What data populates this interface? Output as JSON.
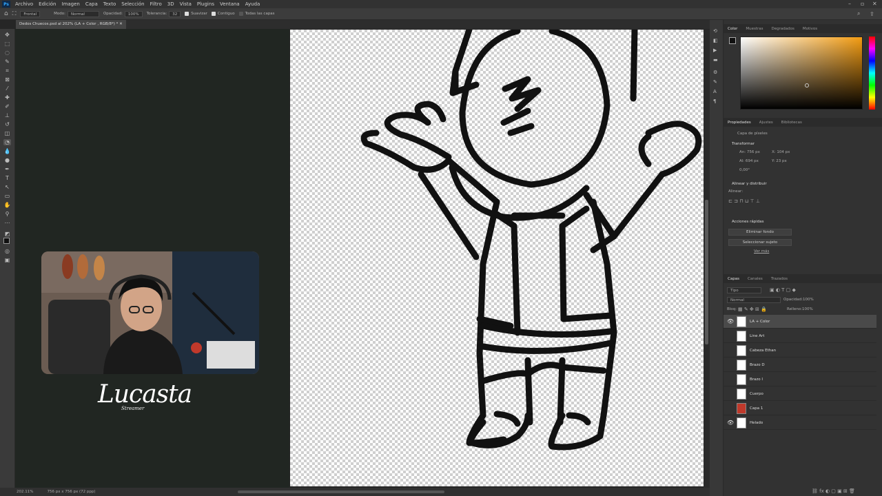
{
  "menu": [
    "Archivo",
    "Edición",
    "Imagen",
    "Capa",
    "Texto",
    "Selección",
    "Filtro",
    "3D",
    "Vista",
    "Plugins",
    "Ventana",
    "Ayuda"
  ],
  "options": {
    "view": "Frontal",
    "mode_label": "Modo:",
    "mode_value": "Normal",
    "opacity_label": "Opacidad:",
    "opacity_value": "100%",
    "tolerance_label": "Tolerancia:",
    "tolerance_value": "32",
    "smooth": "Suavizar",
    "contiguous": "Contiguo",
    "all_layers": "Todas las capas"
  },
  "document_tab": "Dedos Chuecos.psd al 202% (LA + Color , RGB/8*) *",
  "status": {
    "zoom": "202.11%",
    "size": "756 px x 756 px (72 ppp)"
  },
  "brand": {
    "name": "Lucasta",
    "sub": "Streamer"
  },
  "color_panel": {
    "tabs": [
      "Color",
      "Muestras",
      "Degradados",
      "Motivos"
    ]
  },
  "properties": {
    "tabs": [
      "Propiedades",
      "Ajustes",
      "Bibliotecas"
    ],
    "layer_type": "Capa de píxeles",
    "transform": "Transformar",
    "w": "An: 756 px",
    "h": "Al: 694 px",
    "x": "X: 104 px",
    "y": "Y: 23 px",
    "angle": "0,00°",
    "align": "Alinear y distribuir",
    "align_sub": "Alinear:",
    "quick_actions": "Acciones rápidas",
    "remove_bg": "Eliminar fondo",
    "select_subject": "Seleccionar sujeto",
    "more": "Ver más"
  },
  "layers_panel": {
    "tabs": [
      "Capas",
      "Canales",
      "Trazados"
    ],
    "kind": "Tipo",
    "blend": "Normal",
    "opacity_label": "Opacidad:",
    "opacity_value": "100%",
    "lock_label": "Bloq:",
    "fill_label": "Relleno:",
    "fill_value": "100%",
    "layers": [
      {
        "name": "LA + Color",
        "visible": "👁"
      },
      {
        "name": "Line Art",
        "visible": ""
      },
      {
        "name": "Cabeza Ethan",
        "visible": ""
      },
      {
        "name": "Brazo D",
        "visible": ""
      },
      {
        "name": "Brazo I",
        "visible": ""
      },
      {
        "name": "Cuerpo",
        "visible": ""
      },
      {
        "name": "Capa 1",
        "visible": ""
      },
      {
        "name": "Helado",
        "visible": "👁"
      }
    ]
  }
}
